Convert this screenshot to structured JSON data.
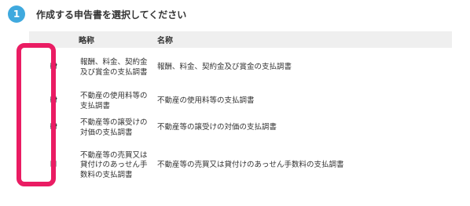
{
  "step": {
    "number": "1",
    "title": "作成する申告書を選択してください"
  },
  "table": {
    "headers": {
      "check": "",
      "abbr": "略称",
      "name": "名称"
    },
    "rows": [
      {
        "abbr": "報酬、料金、契約金及び賞金の支払調書",
        "name": "報酬、料金、契約金及び賞金の支払調書",
        "checked": true
      },
      {
        "abbr": "不動産の使用料等の支払調書",
        "name": "不動産の使用料等の支払調書",
        "checked": true
      },
      {
        "abbr": "不動産等の譲受けの対価の支払調書",
        "name": "不動産等の譲受けの対価の支払調書",
        "checked": true
      },
      {
        "abbr": "不動産等の売買又は貸付けのあっせん手数料の支払調書",
        "name": "不動産等の売買又は貸付けのあっせん手数料の支払調書",
        "checked": false
      }
    ]
  },
  "colors": {
    "step_badge": "#3fa9de",
    "highlight": "#ea1c63",
    "header_bg": "#efefef"
  }
}
